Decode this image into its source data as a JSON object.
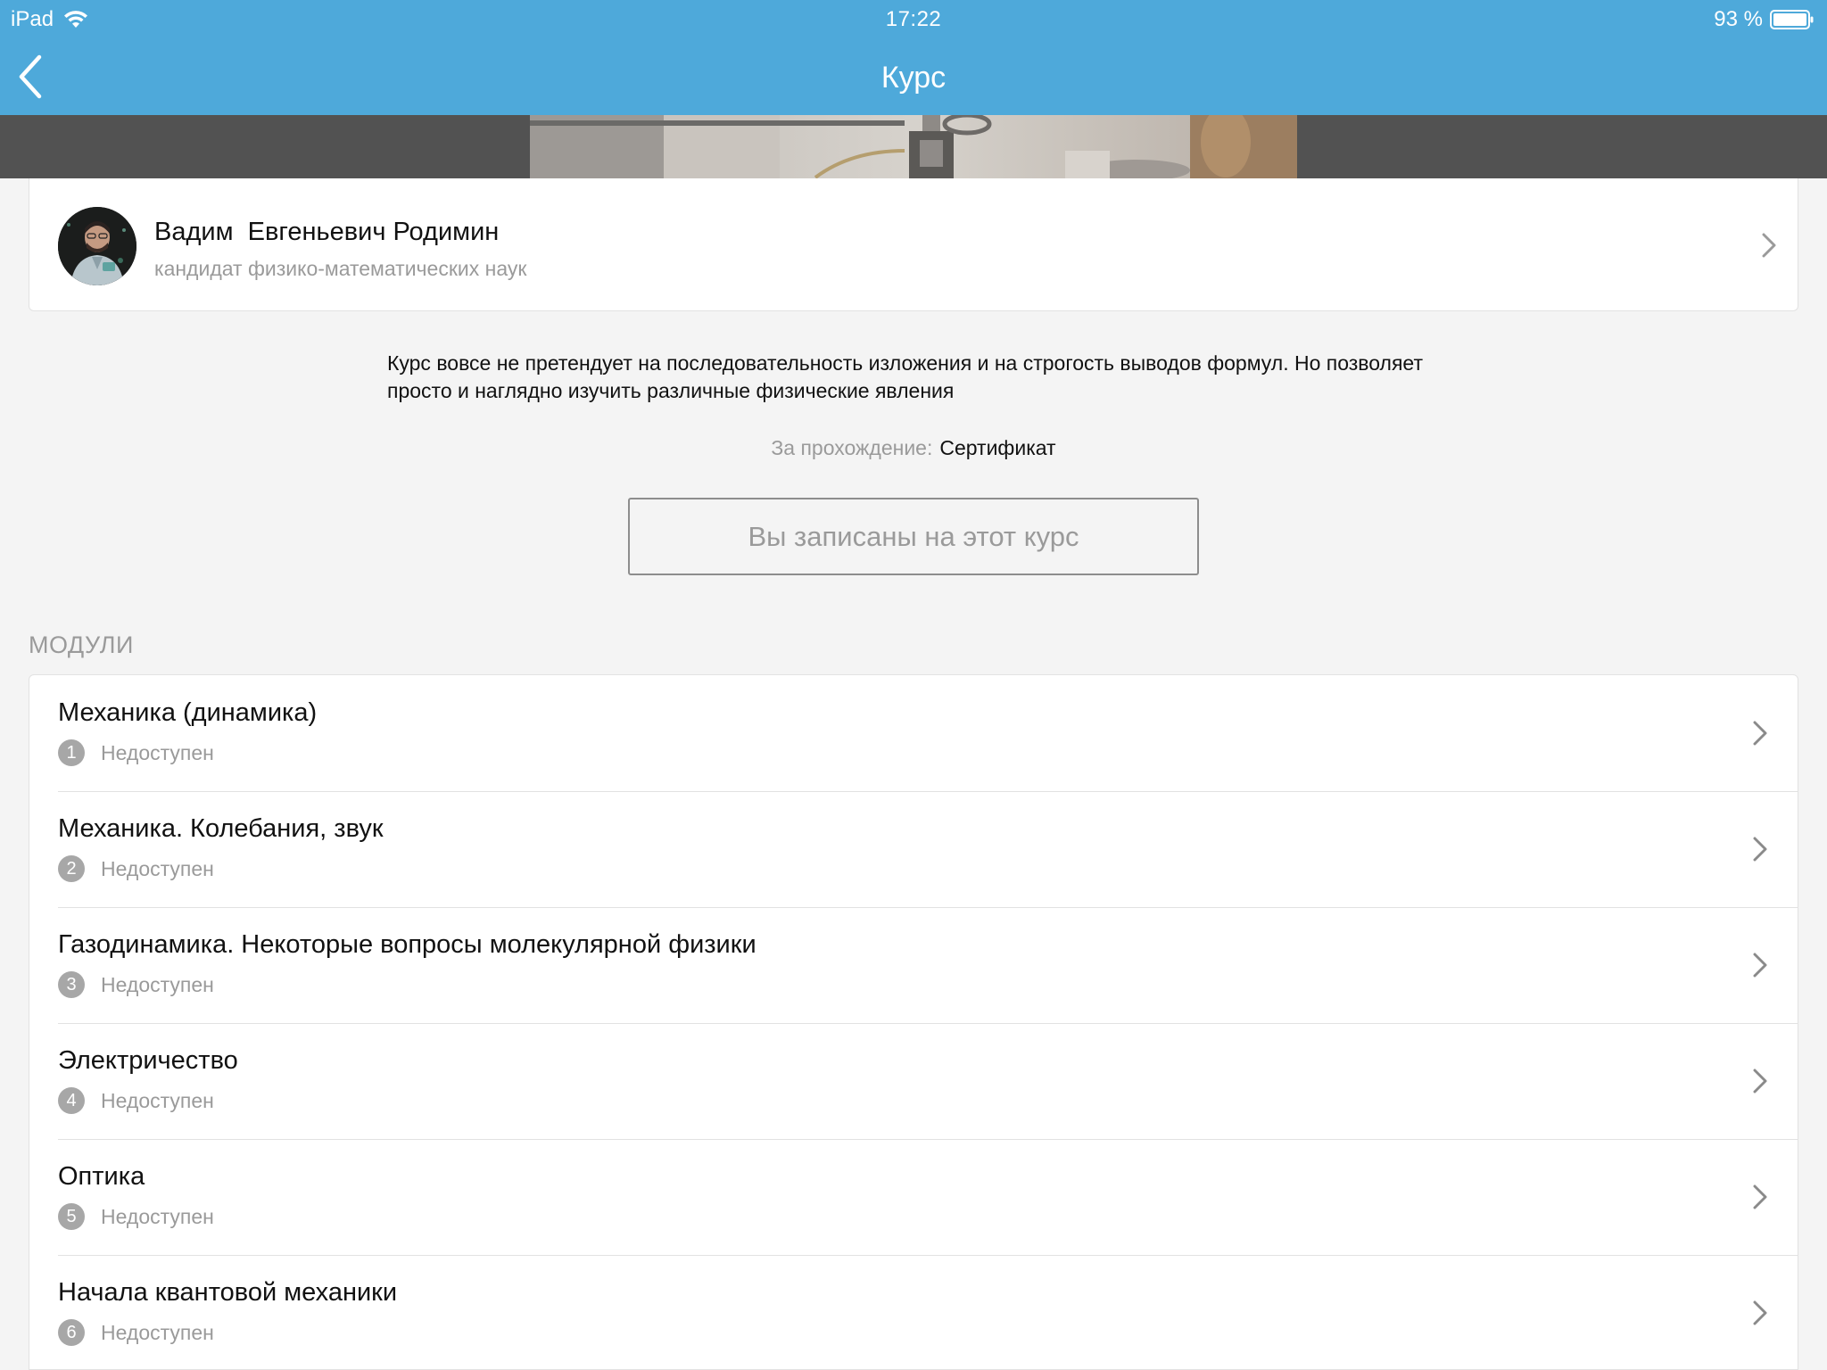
{
  "status_bar": {
    "device": "iPad",
    "time": "17:22",
    "battery": "93 %"
  },
  "nav": {
    "title": "Курс"
  },
  "instructor": {
    "name": "Вадим  Евгеньевич Родимин",
    "title": "кандидат физико-математических наук"
  },
  "course": {
    "description": "Курс вовсе не претендует на последовательность изложения и на строгость выводов формул. Но позволяет просто и наглядно изучить различные физические явления",
    "completion_label": "За прохождение:",
    "completion_value": "Сертификат",
    "enrolled_label": "Вы записаны на этот курс"
  },
  "modules": {
    "header": "МОДУЛИ",
    "items": [
      {
        "number": "1",
        "title": "Механика (динамика)",
        "status": "Недоступен"
      },
      {
        "number": "2",
        "title": "Механика. Колебания, звук",
        "status": "Недоступен"
      },
      {
        "number": "3",
        "title": "Газодинамика. Некоторые вопросы молекулярной физики",
        "status": "Недоступен"
      },
      {
        "number": "4",
        "title": "Электричество",
        "status": "Недоступен"
      },
      {
        "number": "5",
        "title": "Оптика",
        "status": "Недоступен"
      },
      {
        "number": "6",
        "title": "Начала квантовой механики",
        "status": "Недоступен"
      }
    ]
  },
  "colors": {
    "header_blue": "#4ea9da",
    "background": "#f4f4f4",
    "muted_text": "#9a9a9a"
  },
  "icons": {
    "wifi": "wifi-icon",
    "battery": "battery-icon",
    "back": "back-icon",
    "chevron": "chevron-right-icon"
  }
}
